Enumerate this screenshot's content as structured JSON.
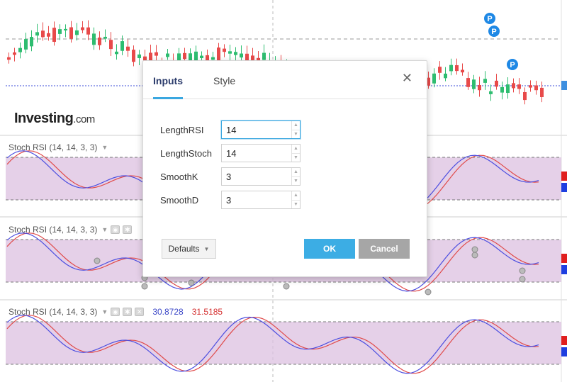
{
  "chart": {
    "logo_main": "Investing",
    "logo_suffix": ".com",
    "indicator_legend": "Stoch RSI (14, 14, 3, 3)",
    "stoch_k_value": "30.8728",
    "stoch_d_value": "31.5185",
    "event_marker": "P",
    "colors": {
      "up_candle": "#2ebd70",
      "down_candle": "#e84a4a",
      "k_line": "#4c4ee0",
      "d_line": "#e04a4a",
      "band_fill": "#dcc0e0"
    }
  },
  "dialog": {
    "tabs": [
      "Inputs",
      "Style"
    ],
    "active_tab": "Inputs",
    "close_icon": "close-icon",
    "fields": [
      {
        "label": "LengthRSI",
        "value": "14"
      },
      {
        "label": "LengthStoch",
        "value": "14"
      },
      {
        "label": "SmoothK",
        "value": "3"
      },
      {
        "label": "SmoothD",
        "value": "3"
      }
    ],
    "defaults_label": "Defaults",
    "ok_label": "OK",
    "cancel_label": "Cancel"
  }
}
